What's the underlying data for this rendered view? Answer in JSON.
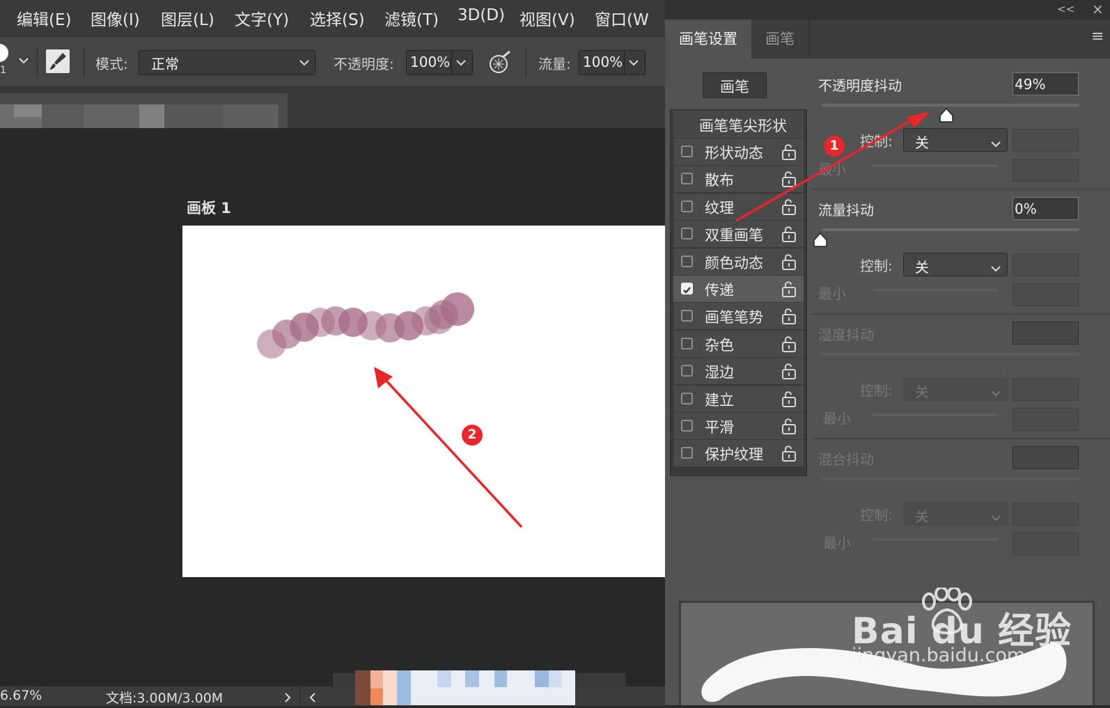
{
  "menubar": {
    "items": [
      "编辑(E)",
      "图像(I)",
      "图层(L)",
      "文字(Y)",
      "选择(S)",
      "滤镜(T)",
      "3D(D)",
      "视图(V)",
      "窗口(W"
    ]
  },
  "options": {
    "brush_size_digit": "1",
    "mode_label": "模式:",
    "mode_value": "正常",
    "opacity_label": "不透明度:",
    "opacity_value": "100%",
    "flow_label": "流量:",
    "flow_value": "100%"
  },
  "document": {
    "artboard_label": "画板 1",
    "stroke_color": "#a66b86"
  },
  "status": {
    "zoom": "6.67%",
    "doc_info": "文档:3.00M/3.00M"
  },
  "panel": {
    "collapse_glyph": "<<",
    "close_glyph": "×",
    "menu_glyph": "≡",
    "tabs": [
      "画笔设置",
      "画笔"
    ],
    "brushes_button": "画笔",
    "tip_shape_header": "画笔笔尖形状",
    "options": [
      {
        "label": "形状动态",
        "checked": false
      },
      {
        "label": "散布",
        "checked": false
      },
      {
        "label": "纹理",
        "checked": false
      },
      {
        "label": "双重画笔",
        "checked": false
      },
      {
        "label": "颜色动态",
        "checked": false
      },
      {
        "label": "传递",
        "checked": true
      },
      {
        "label": "画笔笔势",
        "checked": false
      },
      {
        "label": "杂色",
        "checked": false
      },
      {
        "label": "湿边",
        "checked": false
      },
      {
        "label": "建立",
        "checked": false
      },
      {
        "label": "平滑",
        "checked": false
      },
      {
        "label": "保护纹理",
        "checked": false
      }
    ],
    "sections": [
      {
        "title": "不透明度抖动",
        "value": "49%",
        "control_label": "控制:",
        "control_value": "关",
        "min_label": "最小",
        "enabled": true,
        "slider_fraction": 0.49
      },
      {
        "title": "流量抖动",
        "value": "0%",
        "control_label": "控制:",
        "control_value": "关",
        "min_label": "最小",
        "enabled": true,
        "slider_fraction": 0.0
      },
      {
        "title": "湿度抖动",
        "value": "",
        "control_label": "控制:",
        "control_value": "关",
        "min_label": "最小",
        "enabled": false
      },
      {
        "title": "混合抖动",
        "value": "",
        "control_label": "控制:",
        "control_value": "关",
        "min_label": "最小",
        "enabled": false
      }
    ]
  },
  "annotations": [
    {
      "label": "1",
      "color": "#e8262b"
    },
    {
      "label": "2",
      "color": "#e8262b"
    }
  ],
  "watermark": {
    "brand": "Bai du 经验",
    "url": "jingyan.baidu.com"
  }
}
